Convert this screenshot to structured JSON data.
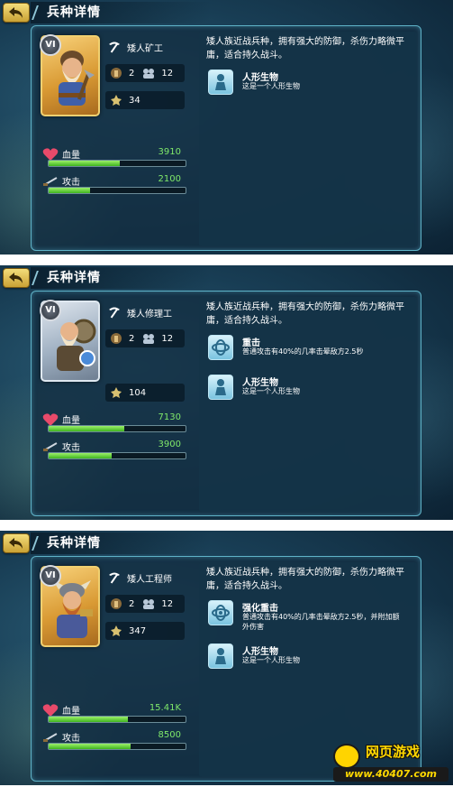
{
  "title": "兵种详情",
  "stat_labels": {
    "hp": "血量",
    "attack": "攻击"
  },
  "colors": {
    "hp_value": "#7fe86a",
    "bar_fill": "#3fb41f",
    "panel_border": "#5fb3c8"
  },
  "screens": [
    {
      "rank": "VI",
      "unit_name": "矮人矿工",
      "space": "2",
      "count": "12",
      "cost": "34",
      "hp": "3910",
      "hp_fill_fraction": 0.52,
      "attack": "2100",
      "attack_fill_fraction": 0.3,
      "description": "矮人族近战兵种，拥有强大的防御，杀伤力略微平庸，适合持久战斗。",
      "traits": [
        {
          "icon": "humanoid-icon",
          "name": "人形生物",
          "desc": "这是一个人形生物"
        }
      ]
    },
    {
      "rank": "VI",
      "unit_name": "矮人修理工",
      "space": "2",
      "count": "12",
      "cost": "104",
      "hp": "7130",
      "hp_fill_fraction": 0.55,
      "attack": "3900",
      "attack_fill_fraction": 0.46,
      "description": "矮人族近战兵种，拥有强大的防御，杀伤力略微平庸，适合持久战斗。",
      "traits": [
        {
          "icon": "heavy-strike-icon",
          "name": "重击",
          "desc": "普通攻击有40%的几率击晕敌方2.5秒"
        },
        {
          "icon": "humanoid-icon",
          "name": "人形生物",
          "desc": "这是一个人形生物"
        }
      ]
    },
    {
      "rank": "VI",
      "unit_name": "矮人工程师",
      "space": "2",
      "count": "12",
      "cost": "347",
      "hp": "15.41K",
      "hp_fill_fraction": 0.58,
      "attack": "8500",
      "attack_fill_fraction": 0.6,
      "description": "矮人族近战兵种，拥有强大的防御，杀伤力略微平庸，适合持久战斗。",
      "traits": [
        {
          "icon": "enhanced-strike-icon",
          "name": "强化重击",
          "desc": "普通攻击有40%的几率击晕敌方2.5秒，并附加额外伤害"
        },
        {
          "icon": "humanoid-icon",
          "name": "人形生物",
          "desc": "这是一个人形生物"
        }
      ]
    }
  ],
  "watermark": {
    "brand": "网页游戏",
    "url": "www.40407.com"
  }
}
